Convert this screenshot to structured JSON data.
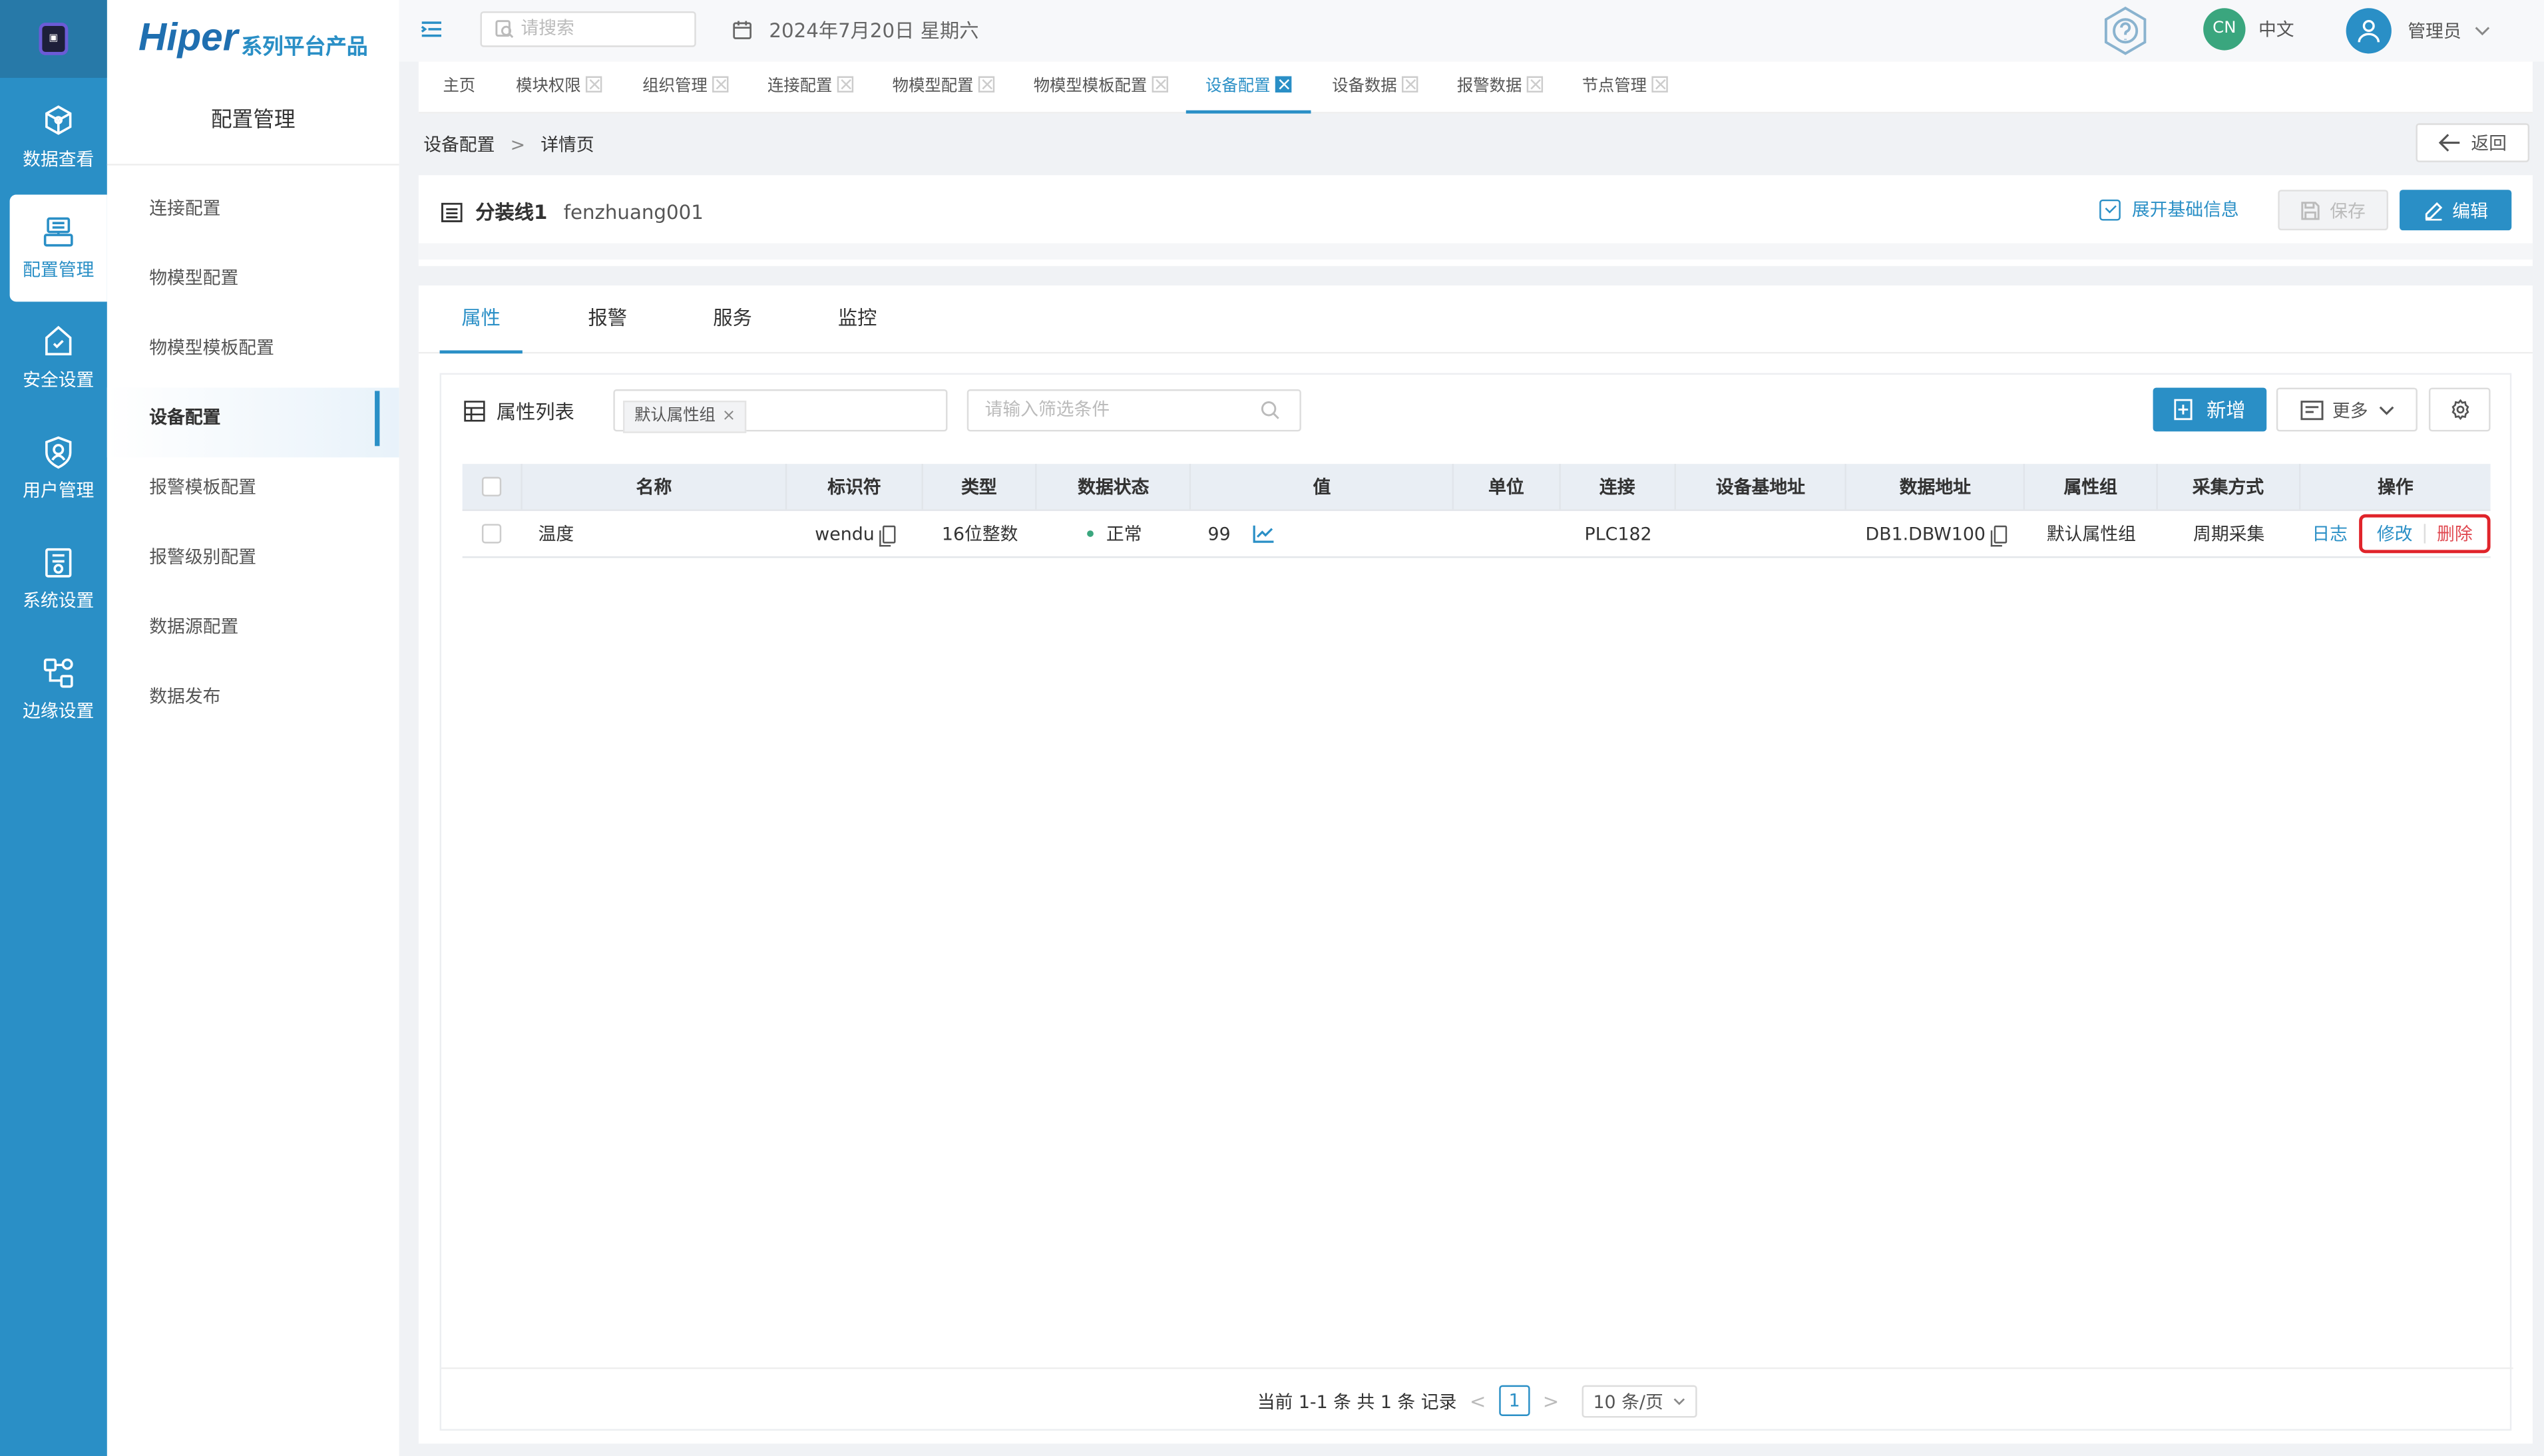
{
  "app": {
    "brand_main": "Hiper",
    "brand_sub": "系列平台产品",
    "logo_text": "▣"
  },
  "rail": [
    {
      "label": "数据查看",
      "icon": "cube-icon"
    },
    {
      "label": "配置管理",
      "icon": "config-icon",
      "active": true
    },
    {
      "label": "安全设置",
      "icon": "shield-home-icon"
    },
    {
      "label": "用户管理",
      "icon": "user-shield-icon"
    },
    {
      "label": "系统设置",
      "icon": "system-settings-icon"
    },
    {
      "label": "边缘设置",
      "icon": "edge-network-icon"
    }
  ],
  "sidebar": {
    "title": "配置管理",
    "items": [
      {
        "label": "连接配置"
      },
      {
        "label": "物模型配置"
      },
      {
        "label": "物模型模板配置"
      },
      {
        "label": "设备配置",
        "active": true
      },
      {
        "label": "报警模板配置"
      },
      {
        "label": "报警级别配置"
      },
      {
        "label": "数据源配置"
      },
      {
        "label": "数据发布"
      }
    ]
  },
  "header": {
    "search_placeholder": "请搜索",
    "date": "2024年7月20日 星期六",
    "lang_badge": "CN",
    "lang_label": "中文",
    "user_name": "管理员"
  },
  "tabs": [
    {
      "label": "主页"
    },
    {
      "label": "模块权限"
    },
    {
      "label": "组织管理"
    },
    {
      "label": "连接配置"
    },
    {
      "label": "物模型配置"
    },
    {
      "label": "物模型模板配置"
    },
    {
      "label": "设备配置",
      "active": true
    },
    {
      "label": "设备数据"
    },
    {
      "label": "报警数据"
    },
    {
      "label": "节点管理"
    }
  ],
  "breadcrumb": {
    "parent": "设备配置",
    "separator": ">",
    "current": "详情页"
  },
  "back_label": "返回",
  "device": {
    "name": "分装线1",
    "code": "fenzhuang001",
    "expand_label": "展开基础信息",
    "save_label": "保存",
    "edit_label": "编辑"
  },
  "subtabs": [
    {
      "label": "属性",
      "active": true
    },
    {
      "label": "报警"
    },
    {
      "label": "服务"
    },
    {
      "label": "监控"
    }
  ],
  "list": {
    "title": "属性列表",
    "group_chip": "默认属性组",
    "filter_placeholder": "请输入筛选条件",
    "add_label": "新增",
    "more_label": "更多"
  },
  "table": {
    "columns": [
      "名称",
      "标识符",
      "类型",
      "数据状态",
      "值",
      "单位",
      "连接",
      "设备基地址",
      "数据地址",
      "属性组",
      "采集方式",
      "操作"
    ],
    "rows": [
      {
        "name": "温度",
        "identifier": "wendu",
        "type": "16位整数",
        "status": "正常",
        "value": "99",
        "unit": "",
        "connection": "PLC182",
        "base_address": "",
        "data_address": "DB1.DBW100",
        "group": "默认属性组",
        "collect": "周期采集",
        "actions": {
          "log": "日志",
          "edit": "修改",
          "delete": "删除"
        }
      }
    ]
  },
  "pager": {
    "summary": "当前 1-1 条 共 1 条 记录",
    "prev": "<",
    "page": "1",
    "next": ">",
    "page_size": "10 条/页"
  },
  "colors": {
    "primary": "#2a8fc6",
    "success": "#3aa67e",
    "danger": "#e0242b"
  }
}
